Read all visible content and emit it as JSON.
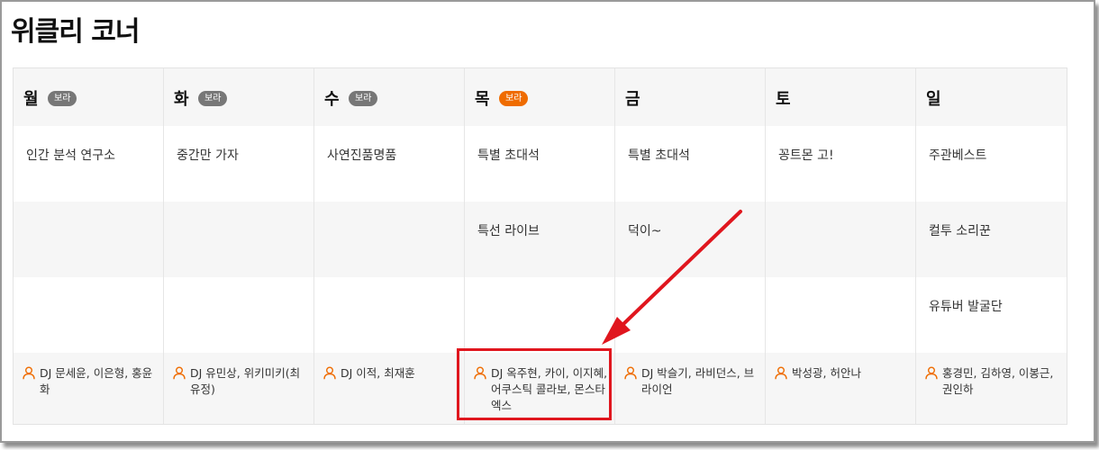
{
  "page": {
    "title": "위클리 코너"
  },
  "badge_label": "보라",
  "colors": {
    "accent": "#ef6c00",
    "badge_gray": "#777777",
    "highlight": "#e0161e"
  },
  "days": [
    {
      "name": "월",
      "badge": true,
      "badge_active": false,
      "programs": [
        "인간 분석 연구소",
        "",
        ""
      ],
      "dj": "DJ 문세윤, 이은형, 홍윤화"
    },
    {
      "name": "화",
      "badge": true,
      "badge_active": false,
      "programs": [
        "중간만 가자",
        "",
        ""
      ],
      "dj": "DJ 유민상, 위키미키(최유정)"
    },
    {
      "name": "수",
      "badge": true,
      "badge_active": false,
      "programs": [
        "사연진품명품",
        "",
        ""
      ],
      "dj": "DJ 이적, 최재훈"
    },
    {
      "name": "목",
      "badge": true,
      "badge_active": true,
      "programs": [
        "특별 초대석",
        "특선 라이브",
        ""
      ],
      "dj": "DJ 옥주현, 카이, 이지혜, 어쿠스틱 콜라보, 몬스타엑스"
    },
    {
      "name": "금",
      "badge": false,
      "badge_active": false,
      "programs": [
        "특별 초대석",
        "덕이~",
        ""
      ],
      "dj": "DJ 박슬기, 라비던스, 브라이언"
    },
    {
      "name": "토",
      "badge": false,
      "badge_active": false,
      "programs": [
        "꽁트몬 고!",
        "",
        ""
      ],
      "dj": "박성광, 허안나"
    },
    {
      "name": "일",
      "badge": false,
      "badge_active": false,
      "programs": [
        "주관베스트",
        "컬투 소리꾼",
        "유튜버 발굴단"
      ],
      "dj": "홍경민, 김하영, 이봉근, 권인하"
    }
  ]
}
